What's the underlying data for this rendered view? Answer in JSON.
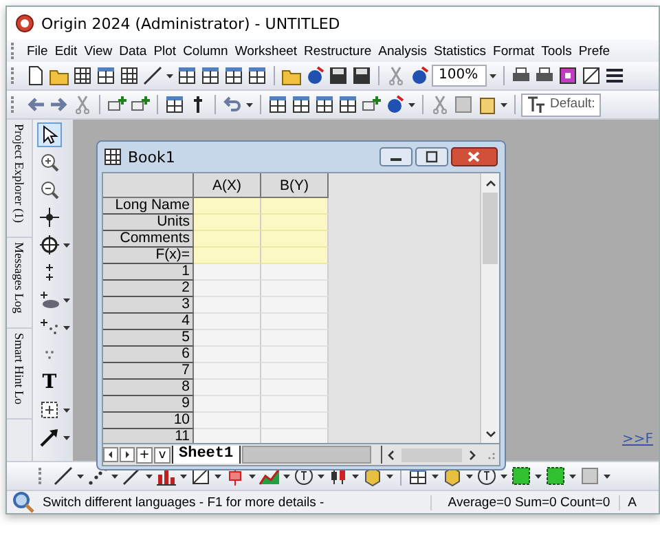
{
  "window": {
    "title": "Origin 2024 (Administrator) - UNTITLED"
  },
  "menu": [
    "File",
    "Edit",
    "View",
    "Data",
    "Plot",
    "Column",
    "Worksheet",
    "Restructure",
    "Analysis",
    "Statistics",
    "Format",
    "Tools",
    "Prefe"
  ],
  "zoom_combo": {
    "value": "100%"
  },
  "font_combo": {
    "value": "Default:"
  },
  "side_tabs": [
    "Project Explorer (1)",
    "Messages Log",
    "Smart Hint Lo"
  ],
  "tools": [
    {
      "kind": "pointer",
      "selected": true
    },
    {
      "kind": "zoom-in",
      "selected": false
    },
    {
      "kind": "zoom-out",
      "selected": false
    },
    {
      "kind": "reader",
      "selected": false
    },
    {
      "kind": "target",
      "selected": false
    },
    {
      "kind": "points",
      "selected": false
    },
    {
      "kind": "ellipse",
      "selected": false
    },
    {
      "kind": "scatter",
      "selected": false
    },
    {
      "kind": "region",
      "selected": false
    },
    {
      "kind": "text",
      "glyph": "T",
      "selected": false
    },
    {
      "kind": "rectangle",
      "selected": false
    },
    {
      "kind": "arrow",
      "selected": false
    }
  ],
  "book": {
    "title": "Book1",
    "columns": [
      "A(X)",
      "B(Y)"
    ],
    "header_rows": [
      "Long Name",
      "Units",
      "Comments",
      "F(x)="
    ],
    "rows": [
      "1",
      "2",
      "3",
      "4",
      "5",
      "6",
      "7",
      "8",
      "9",
      "10",
      "11"
    ],
    "nav_buttons": [
      "+",
      "v"
    ],
    "sheets": [
      {
        "label": "Sheet1",
        "selected": true
      }
    ]
  },
  "workspace_link": ">>F",
  "status_bar": {
    "hint": "Switch different languages  - F1 for more details -",
    "stats": "Average=0 Sum=0 Count=0",
    "extra": "A"
  }
}
